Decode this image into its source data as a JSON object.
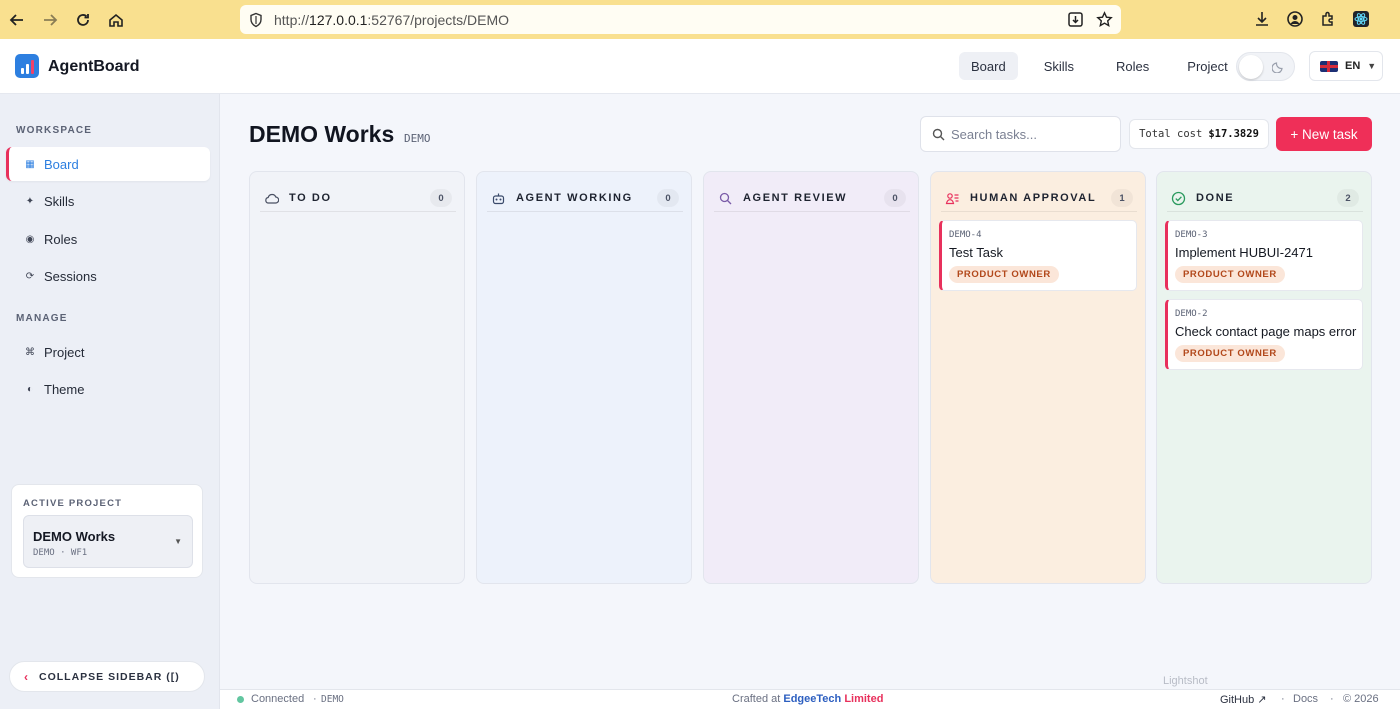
{
  "browser": {
    "url_prefix": "http://",
    "url_host": "127.0.0.1",
    "url_rest": ":52767/projects/DEMO"
  },
  "header": {
    "app_name": "AgentBoard",
    "nav": [
      "Board",
      "Skills",
      "Roles",
      "Project"
    ],
    "active_nav": "Board",
    "language": "EN"
  },
  "sidebar": {
    "workspace_title": "WORKSPACE",
    "workspace_items": [
      {
        "label": "Board",
        "icon": "grid-icon",
        "glyph": "▦"
      },
      {
        "label": "Skills",
        "icon": "sparkle-icon",
        "glyph": "✦"
      },
      {
        "label": "Roles",
        "icon": "target-icon",
        "glyph": "◉"
      },
      {
        "label": "Sessions",
        "icon": "refresh-icon",
        "glyph": "⟳"
      }
    ],
    "manage_title": "MANAGE",
    "manage_items": [
      {
        "label": "Project",
        "icon": "command-icon",
        "glyph": "⌘"
      },
      {
        "label": "Theme",
        "icon": "half-circle-icon",
        "glyph": "◐"
      }
    ],
    "active_project_label": "ACTIVE PROJECT",
    "active_project_name": "DEMO Works",
    "active_project_sub": "DEMO · WF1",
    "collapse_label": "COLLAPSE SIDEBAR ([)"
  },
  "main": {
    "title": "DEMO Works",
    "key": "DEMO",
    "search_placeholder": "Search tasks...",
    "cost_label": "Total cost",
    "cost_value": "$17.3829",
    "new_task_label": "+ New task"
  },
  "columns": [
    {
      "title": "TO DO",
      "count": "0",
      "icon": "cloud-icon",
      "bg": "#f1f3f8",
      "cards": []
    },
    {
      "title": "AGENT WORKING",
      "count": "0",
      "icon": "robot-icon",
      "bg": "#edf2fb",
      "cards": []
    },
    {
      "title": "AGENT REVIEW",
      "count": "0",
      "icon": "search-icon",
      "bg": "#f1ecf8",
      "cards": []
    },
    {
      "title": "HUMAN APPROVAL",
      "count": "1",
      "icon": "approval-icon",
      "bg": "#fbeee0",
      "cards": [
        {
          "key": "DEMO-4",
          "title": "Test Task",
          "badge": "PRODUCT OWNER"
        }
      ]
    },
    {
      "title": "DONE",
      "count": "2",
      "icon": "check-circle-icon",
      "bg": "#eaf4ee",
      "cards": [
        {
          "key": "DEMO-3",
          "title": "Implement HUBUI-2471",
          "badge": "PRODUCT OWNER"
        },
        {
          "key": "DEMO-2",
          "title": "Check contact page maps error",
          "badge": "PRODUCT OWNER"
        }
      ]
    }
  ],
  "footer": {
    "status": "Connected",
    "separator": "·",
    "project": "DEMO",
    "crafted_prefix": "Crafted at",
    "brand_main": "EdgeeTech",
    "brand_suffix": "Limited",
    "github": "GitHub ↗",
    "docs": "Docs",
    "copyright": "© 2026"
  },
  "overlay": {
    "watermark": "Lightshot"
  },
  "colors": {
    "accent": "#ef2f58",
    "primary": "#2d7fe0",
    "browser_bar": "#f9e08f"
  }
}
